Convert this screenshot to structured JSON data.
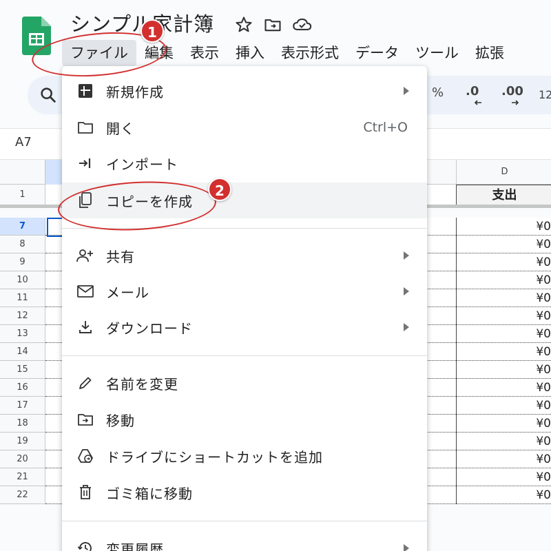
{
  "doc": {
    "title": "シンプル家計簿"
  },
  "menubar": [
    "ファイル",
    "編集",
    "表示",
    "挿入",
    "表示形式",
    "データ",
    "ツール",
    "拡張"
  ],
  "toolbar": {
    "percent": "%",
    "dec_decrease": ".0",
    "dec_increase": ".00",
    "number_format": "12"
  },
  "name_box": "A7",
  "sheet": {
    "column_d_header": "D",
    "column_d_title": "支出",
    "selected_row": "7",
    "rows": [
      "1",
      "7",
      "8",
      "9",
      "10",
      "11",
      "12",
      "13",
      "14",
      "15",
      "16",
      "17",
      "18",
      "19",
      "20",
      "21",
      "22"
    ],
    "d_values": [
      "¥0",
      "¥0",
      "¥0",
      "¥0",
      "¥0",
      "¥0",
      "¥0",
      "¥0",
      "¥0",
      "¥0",
      "¥0",
      "¥0",
      "¥0",
      "¥0",
      "¥0",
      "¥0"
    ]
  },
  "file_menu": {
    "items": [
      {
        "label": "新規作成",
        "icon": "new-sheet-icon",
        "submenu": true
      },
      {
        "label": "開く",
        "icon": "folder-icon",
        "shortcut": "Ctrl+O"
      },
      {
        "label": "インポート",
        "icon": "import-icon"
      },
      {
        "label": "コピーを作成",
        "icon": "copy-icon"
      },
      {
        "label": "共有",
        "icon": "person-add-icon",
        "submenu": true
      },
      {
        "label": "メール",
        "icon": "mail-icon",
        "submenu": true
      },
      {
        "label": "ダウンロード",
        "icon": "download-icon",
        "submenu": true
      },
      {
        "label": "名前を変更",
        "icon": "pencil-icon"
      },
      {
        "label": "移動",
        "icon": "move-folder-icon"
      },
      {
        "label": "ドライブにショートカットを追加",
        "icon": "drive-shortcut-icon"
      },
      {
        "label": "ゴミ箱に移動",
        "icon": "trash-icon"
      },
      {
        "label": "変更履歴",
        "icon": "history-icon",
        "submenu": true
      }
    ]
  },
  "annotations": {
    "step1": "1",
    "step2": "2",
    "color": "#d32f2f"
  }
}
